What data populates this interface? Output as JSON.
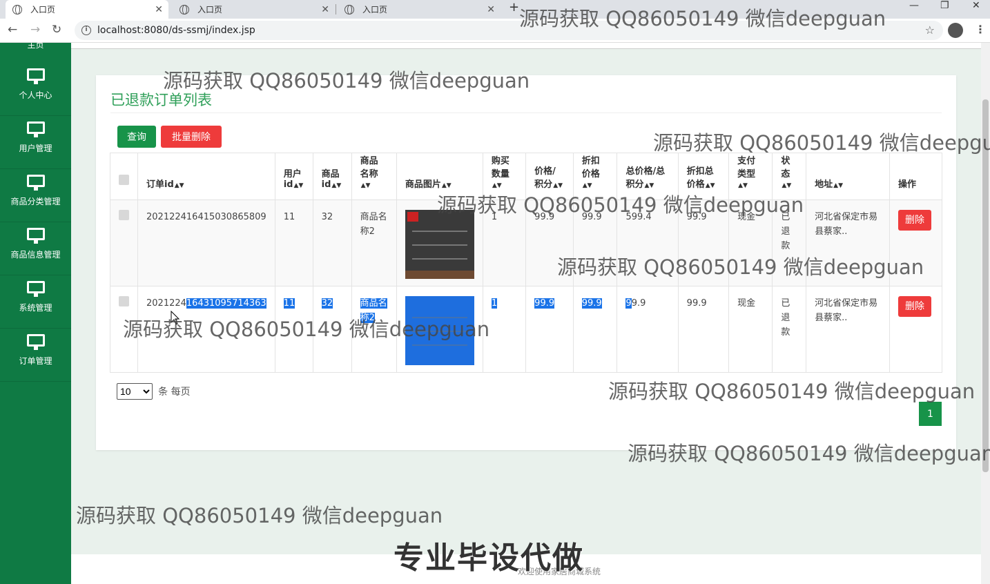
{
  "browser": {
    "tabs": [
      {
        "title": "入口页",
        "active": true
      },
      {
        "title": "入口页",
        "active": false
      },
      {
        "title": "入口页",
        "active": false
      }
    ],
    "url": "localhost:8080/ds-ssmj/index.jsp"
  },
  "sidebar": {
    "top_label": "主页",
    "items": [
      {
        "label": "个人中心"
      },
      {
        "label": "用户管理"
      },
      {
        "label": "商品分类管理"
      },
      {
        "label": "商品信息管理"
      },
      {
        "label": "系统管理"
      },
      {
        "label": "订单管理"
      }
    ]
  },
  "main": {
    "title": "已退款订单列表",
    "query_button": "查询",
    "batch_delete_button": "批量删除",
    "columns": [
      "订单id",
      "用户id",
      "商品名称",
      "商品图片",
      "购买数量",
      "价格/积分",
      "折扣价格",
      "总价格/总积分",
      "折扣总价格",
      "支付类型",
      "状态",
      "地址",
      "操作"
    ],
    "headers": {
      "order_id": "订单id",
      "user_id_1": "用户",
      "user_id_2": "id",
      "goods_id_1": "商品",
      "goods_id_2": "id",
      "goods_name_1": "商品",
      "goods_name_2": "名称",
      "goods_img": "商品图片",
      "qty_1": "购买",
      "qty_2": "数量",
      "price_1": "价格/",
      "price_2": "积分",
      "discount_1": "折扣",
      "discount_2": "价格",
      "total_1": "总价格/总",
      "total_2": "积分",
      "dtotal_1": "折扣总",
      "dtotal_2": "价格",
      "pay_1": "支付",
      "pay_2": "类型",
      "status_1": "状",
      "status_2": "态",
      "address": "地址",
      "action": "操作"
    },
    "rows": [
      {
        "order_id": "20212241641503086580​9",
        "order_id_display": "202122416415030865809",
        "user_id": "11",
        "goods_id": "32",
        "goods_name": "商品名称2",
        "qty": "1",
        "price": "99.9",
        "discount_price": "99.9",
        "total": "599.4",
        "discount_total": "99.9",
        "pay_type": "现金",
        "status": "已退款",
        "address": "河北省保定市易县蔡家..",
        "action": "删除"
      },
      {
        "order_id_a": "2021224",
        "order_id_b": "16431095714363",
        "user_id": "11",
        "goods_id": "32",
        "goods_name": "商品名称2",
        "qty": "1",
        "price": "99.9",
        "discount_price": "99.9",
        "total_a": "9",
        "total_b": "9.9",
        "discount_total": "99.9",
        "pay_type": "现金",
        "status": "已退款",
        "address": "河北省保定市易县蔡家..",
        "action": "删除"
      }
    ],
    "page_size": "10",
    "page_size_suffix": "条 每页",
    "current_page": "1"
  },
  "footer": {
    "text": "欢迎使用家居商城系统"
  },
  "watermarks": {
    "qq": "源码获取 QQ86050149 微信deepguan",
    "big": "专业毕设代做"
  },
  "colors": {
    "sidebar": "#0f7a44",
    "title_green": "#30a05a",
    "button_green": "#179349",
    "button_red": "#ee3b3b",
    "selection": "#1a73e8"
  }
}
